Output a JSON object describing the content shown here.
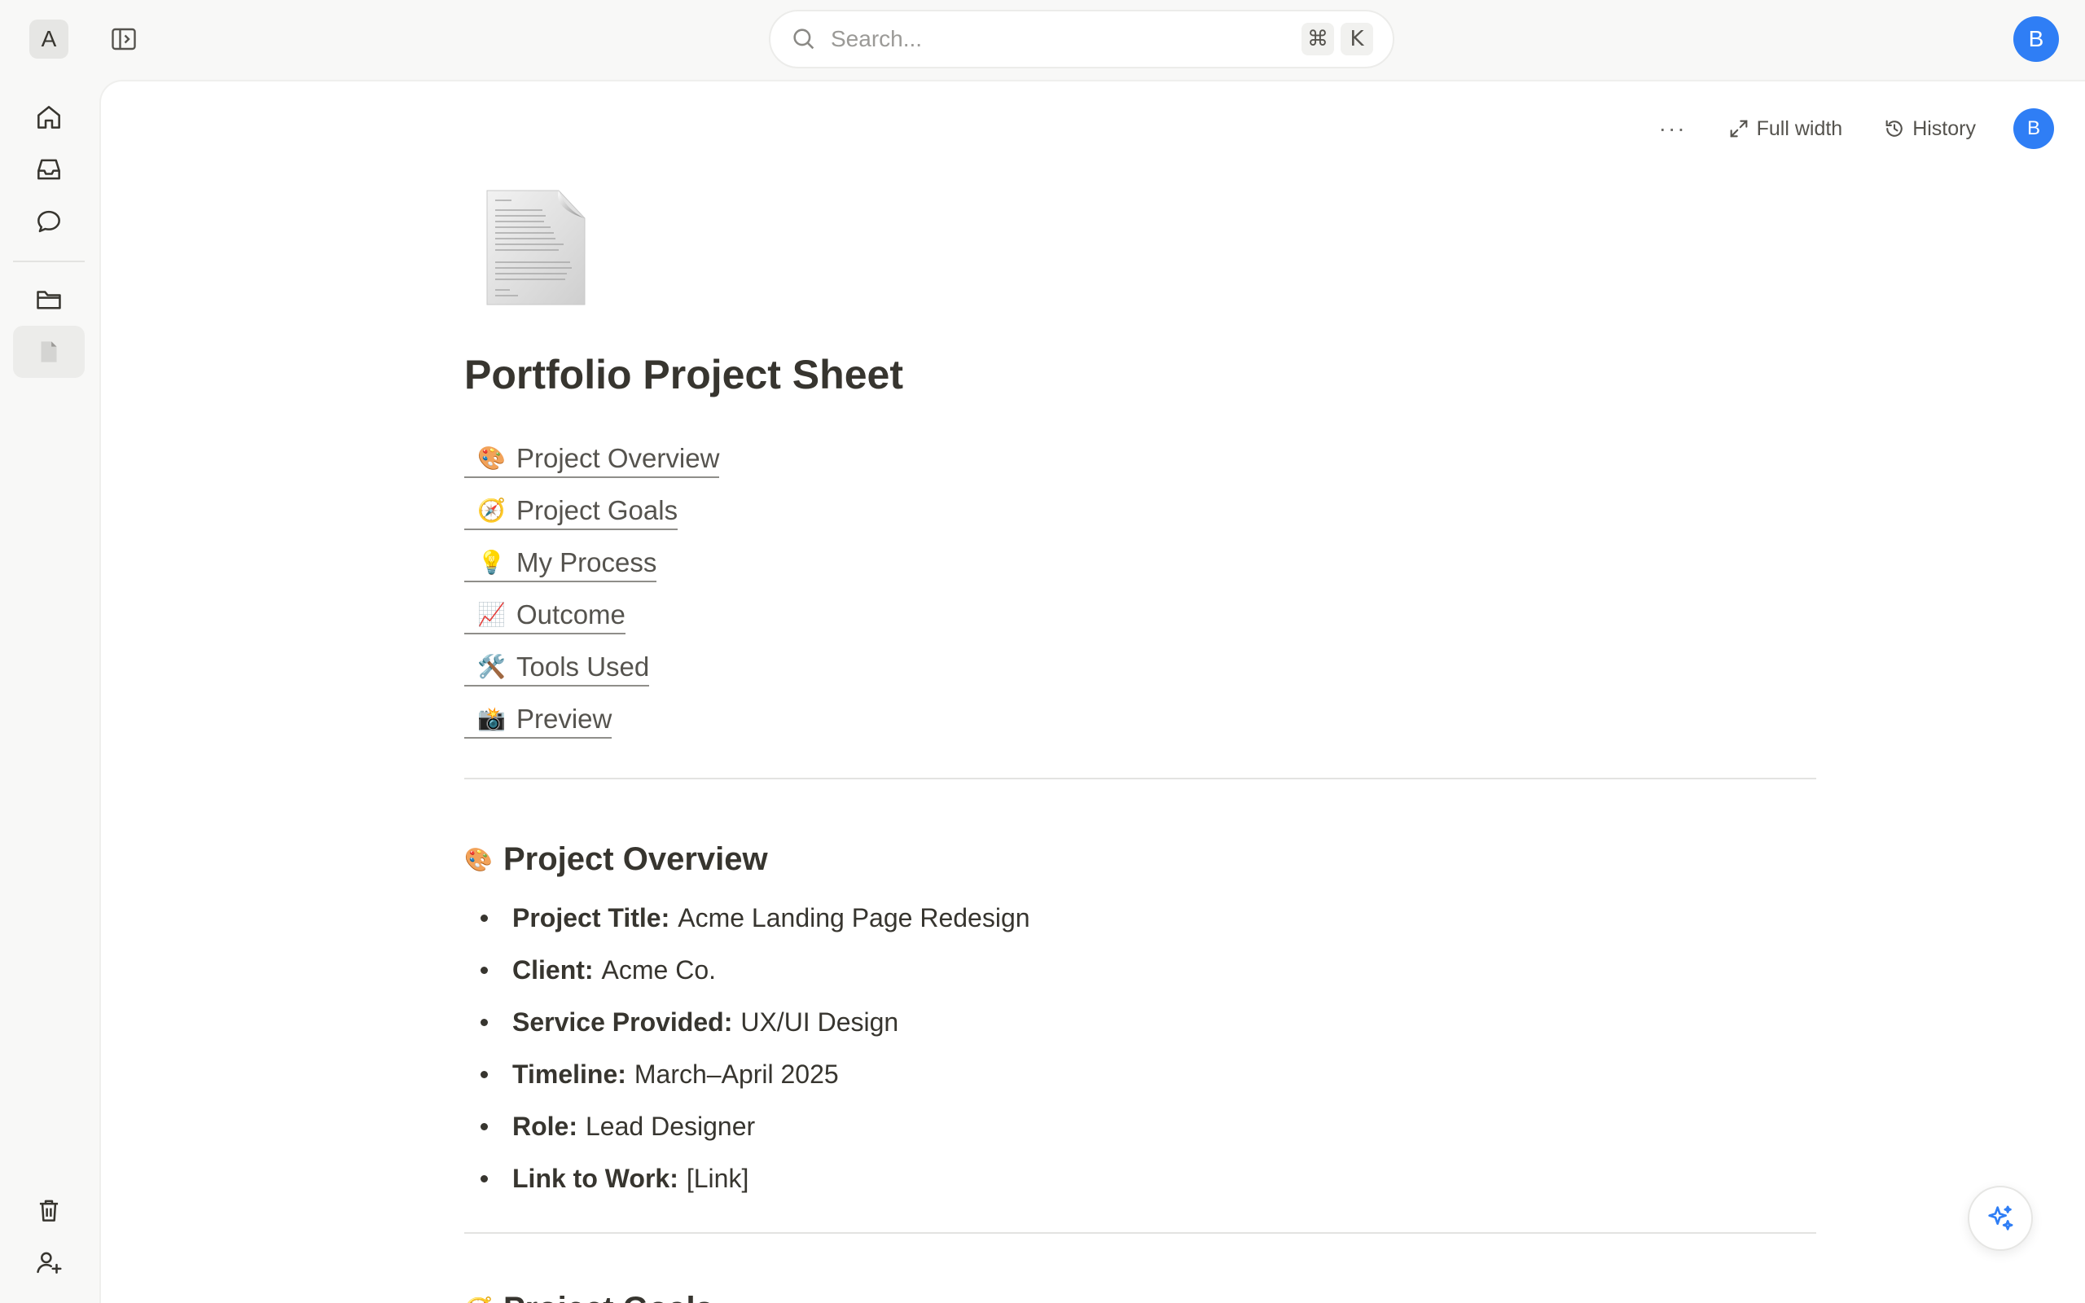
{
  "workspace": {
    "initial": "A"
  },
  "search": {
    "placeholder": "Search...",
    "shortcut_keys": [
      "⌘",
      "K"
    ]
  },
  "user": {
    "initial": "B",
    "avatar_color": "#2f7ef5"
  },
  "rail": {
    "items": [
      "home-icon",
      "inbox-icon",
      "chat-bubble-icon",
      "folder-icon",
      "document-icon"
    ],
    "bottom_items": [
      "trash-icon",
      "add-user-icon"
    ]
  },
  "doc_toolbar": {
    "more_label": "···",
    "full_width_label": "Full width",
    "history_label": "History"
  },
  "document": {
    "title": "Portfolio Project Sheet",
    "toc": [
      {
        "emoji": "🎨",
        "label": "Project Overview"
      },
      {
        "emoji": "🧭",
        "label": "Project Goals"
      },
      {
        "emoji": "💡",
        "label": "My Process"
      },
      {
        "emoji": "📈",
        "label": "Outcome"
      },
      {
        "emoji": "🛠️",
        "label": "Tools Used"
      },
      {
        "emoji": "📸",
        "label": "Preview"
      }
    ],
    "overview": {
      "emoji": "🎨",
      "heading": "Project Overview",
      "fields": [
        {
          "key": "Project Title:",
          "value": "Acme Landing Page Redesign"
        },
        {
          "key": "Client:",
          "value": "Acme Co."
        },
        {
          "key": "Service Provided:",
          "value": "UX/UI Design"
        },
        {
          "key": "Timeline:",
          "value": "March–April 2025"
        },
        {
          "key": "Role:",
          "value": "Lead Designer"
        },
        {
          "key": "Link to Work:",
          "value": "[Link]"
        }
      ]
    },
    "next_section": {
      "emoji": "🧭",
      "heading": "Project Goals"
    }
  },
  "colors": {
    "accent": "#2f7ef5",
    "text": "#37352f",
    "background": "#f8f8f7"
  }
}
